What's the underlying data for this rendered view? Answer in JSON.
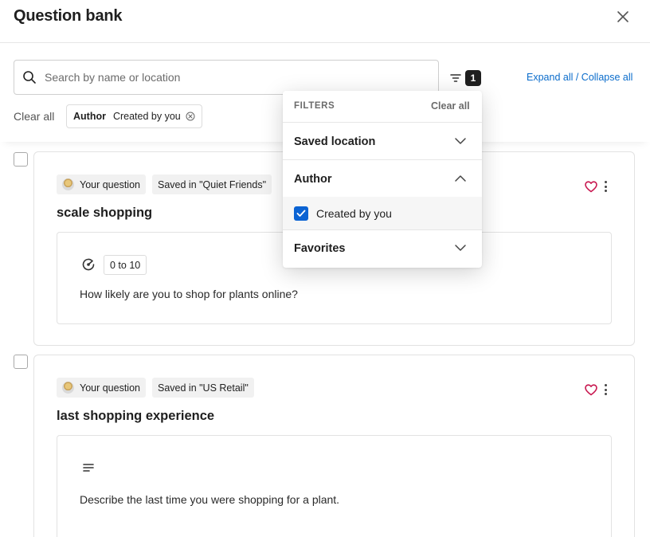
{
  "header": {
    "title": "Question bank"
  },
  "search": {
    "placeholder": "Search by name or location",
    "value": ""
  },
  "filter_toggle": {
    "count": "1"
  },
  "expand_links": {
    "expand": "Expand all",
    "separator": " / ",
    "collapse": "Collapse all"
  },
  "active_filters": {
    "clear_all": "Clear all",
    "chips": [
      {
        "key": "Author",
        "value": "Created by you"
      }
    ]
  },
  "filters_dropdown": {
    "heading": "FILTERS",
    "clear_all": "Clear all",
    "sections": [
      {
        "title": "Saved location",
        "expanded": false
      },
      {
        "title": "Author",
        "expanded": true,
        "options": [
          {
            "label": "Created by you",
            "checked": true
          }
        ]
      },
      {
        "title": "Favorites",
        "expanded": false
      }
    ]
  },
  "questions": [
    {
      "author_tag": "Your question",
      "location_tag": "Saved in \"Quiet Friends\"",
      "title": "scale shopping",
      "type_icon": "gauge-icon",
      "range": "0 to 10",
      "text": "How likely are you to shop for plants online?"
    },
    {
      "author_tag": "Your question",
      "location_tag": "Saved in \"US Retail\"",
      "title": "last shopping experience",
      "type_icon": "text-lines-icon",
      "text": "Describe the last time you were shopping for a plant."
    }
  ],
  "colors": {
    "accent": "#0b63d3",
    "link": "#0a6ccb",
    "favorite": "#c8174f",
    "badge": "#1f1f1f"
  }
}
